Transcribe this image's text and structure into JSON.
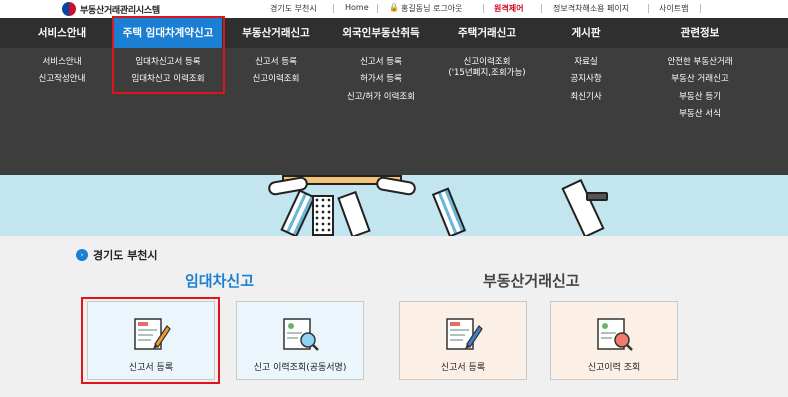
{
  "header": {
    "logo_text": "부동산거래관리시스템",
    "region_label": "경기도 부천시",
    "home": "Home",
    "user_logout": "홍길동님 로그아웃",
    "remote_control": "원격제어",
    "privacy": "정보격차해소용 페이지",
    "sitemap": "사이트맵"
  },
  "nav": [
    {
      "label": "서비스안내",
      "items": [
        "서비스안내",
        "신고작성안내"
      ]
    },
    {
      "label": "주택 임대차계약신고",
      "items": [
        "임대차신고서 등록",
        "임대차신고 이력조회"
      ],
      "active": true
    },
    {
      "label": "부동산거래신고",
      "items": [
        "신고서 등록",
        "신고이력조회"
      ]
    },
    {
      "label": "외국인부동산취득",
      "items": [
        "신고서 등록",
        "허가서 등록",
        "신고/허가 이력조회"
      ]
    },
    {
      "label": "주택거래신고",
      "items": [
        "신고이력조회",
        "('15년폐지,조회가능)"
      ]
    },
    {
      "label": "게시판",
      "items": [
        "자료실",
        "공지사항",
        "최신기사"
      ]
    },
    {
      "label": "관련정보",
      "items": [
        "안전한 부동산거래",
        "부동산 거래신고",
        "부동산 등기",
        "부동산 서식"
      ]
    }
  ],
  "main": {
    "region_title": "경기도 부천시",
    "section_lease": "임대차신고",
    "section_trade": "부동산거래신고",
    "cards": [
      {
        "label": "신고서 등록",
        "icon": "pencil-document-icon",
        "theme": "blue"
      },
      {
        "label": "신고 이력조회(공동서명)",
        "icon": "magnifier-document-icon",
        "theme": "blue"
      },
      {
        "label": "신고서 등록",
        "icon": "pencil-document-icon",
        "theme": "peach"
      },
      {
        "label": "신고이력 조회",
        "icon": "magnifier-document-icon",
        "theme": "peach"
      }
    ]
  },
  "colors": {
    "accent": "#1b7fd3",
    "nav_bg": "#2f2f2f",
    "highlight": "#e0141c",
    "hero": "#c3e5ef"
  }
}
